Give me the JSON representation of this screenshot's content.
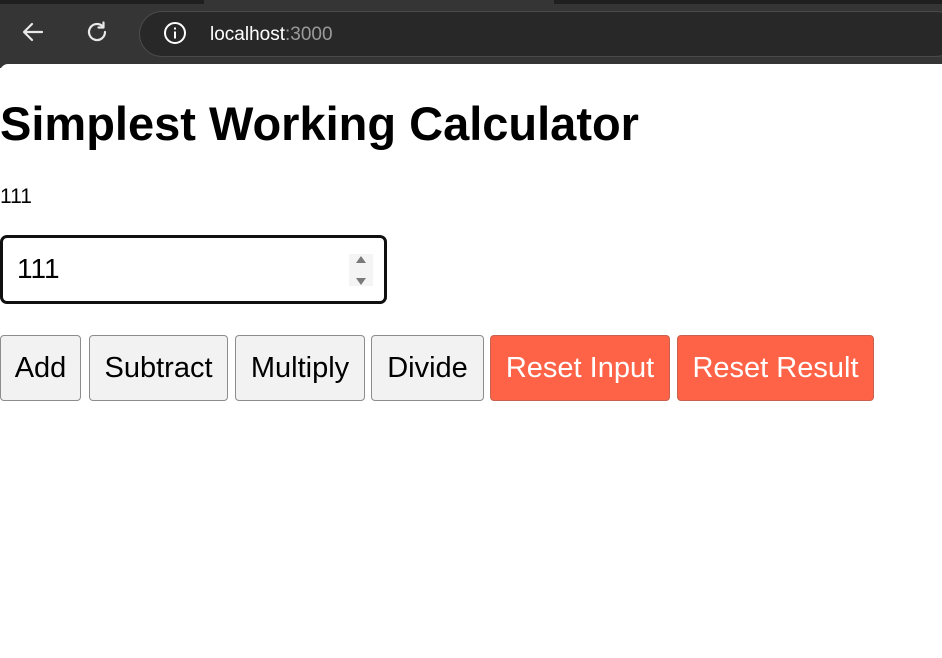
{
  "browser": {
    "url_host": "localhost",
    "url_port": ":3000"
  },
  "page": {
    "title": "Simplest Working Calculator",
    "result": "111"
  },
  "input": {
    "value": "111"
  },
  "buttons": {
    "add": "Add",
    "subtract": "Subtract",
    "multiply": "Multiply",
    "divide": "Divide",
    "reset_input": "Reset Input",
    "reset_result": "Reset Result"
  },
  "colors": {
    "reset_button_bg": "#ff6347",
    "browser_chrome": "#353535"
  },
  "icons": {
    "back": "back-arrow-icon",
    "reload": "reload-icon",
    "site_info": "info-icon",
    "spin_up": "triangle-up-icon",
    "spin_down": "triangle-down-icon"
  }
}
